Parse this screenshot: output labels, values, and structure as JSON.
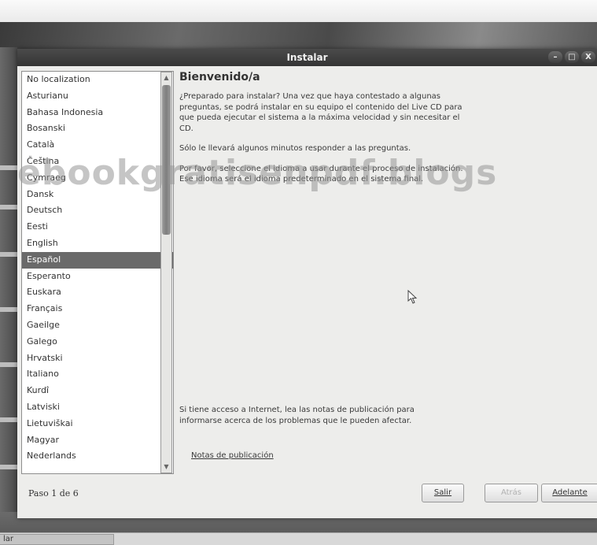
{
  "window": {
    "title": "Instalar"
  },
  "wm_buttons": [
    "–",
    "□",
    "X"
  ],
  "languages": [
    "No localization",
    "Asturianu",
    "Bahasa Indonesia",
    "Bosanski",
    "Català",
    "Čeština",
    "Cymraeg",
    "Dansk",
    "Deutsch",
    "Eesti",
    "English",
    "Español",
    "Esperanto",
    "Euskara",
    "Français",
    "Gaeilge",
    "Galego",
    "Hrvatski",
    "Italiano",
    "Kurdî",
    "Latviski",
    "Lietuviškai",
    "Magyar",
    "Nederlands"
  ],
  "selected_language": "Español",
  "content": {
    "heading": "Bienvenido/a",
    "para1": "¿Preparado para instalar? Una vez que haya contestado a algunas preguntas, se podrá instalar en su equipo el contenido del Live CD para que pueda ejecutar el sistema a la máxima velocidad y sin necesitar el CD.",
    "para2": "Sólo le llevará algunos minutos responder a las preguntas.",
    "para3": "Por favor, seleccione el idioma a usar durante el proceso de instalación. Ese idioma será el idioma predeterminado en el sistema final.",
    "notes_text": "Si tiene acceso a Internet, lea las notas de publicación para informarse acerca de los problemas que le pueden afectar.",
    "notes_link": "Notas de publicación"
  },
  "footer": {
    "step": "Paso 1 de 6",
    "quit_label": "Salir",
    "back_label": "Atrás",
    "forward_label": "Adelante"
  },
  "watermark": "ebookgratisenpdf.blogs",
  "taskbar": {
    "item_label": "lar"
  }
}
